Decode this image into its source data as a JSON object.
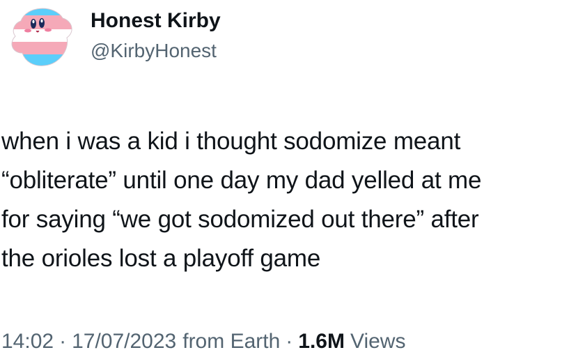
{
  "user": {
    "display_name": "Honest Kirby",
    "handle": "@KirbyHonest",
    "avatar_icon": "kirby-trans-flag-avatar"
  },
  "tweet": {
    "text": "when i was a kid i thought sodomize meant\n“obliterate” until one day my dad yelled at me\nfor saying “we got sodomized out there” after\nthe orioles lost a playoff game"
  },
  "meta": {
    "time": "14:02",
    "separator": "·",
    "date": "17/07/2023",
    "source": "from Earth",
    "views_count": "1.6M",
    "views_label": "Views"
  },
  "colors": {
    "text": "#0f1419",
    "muted": "#536471",
    "avatar_blue": "#5bcefa",
    "avatar_pink": "#f5a9b8",
    "avatar_white": "#ffffff"
  }
}
